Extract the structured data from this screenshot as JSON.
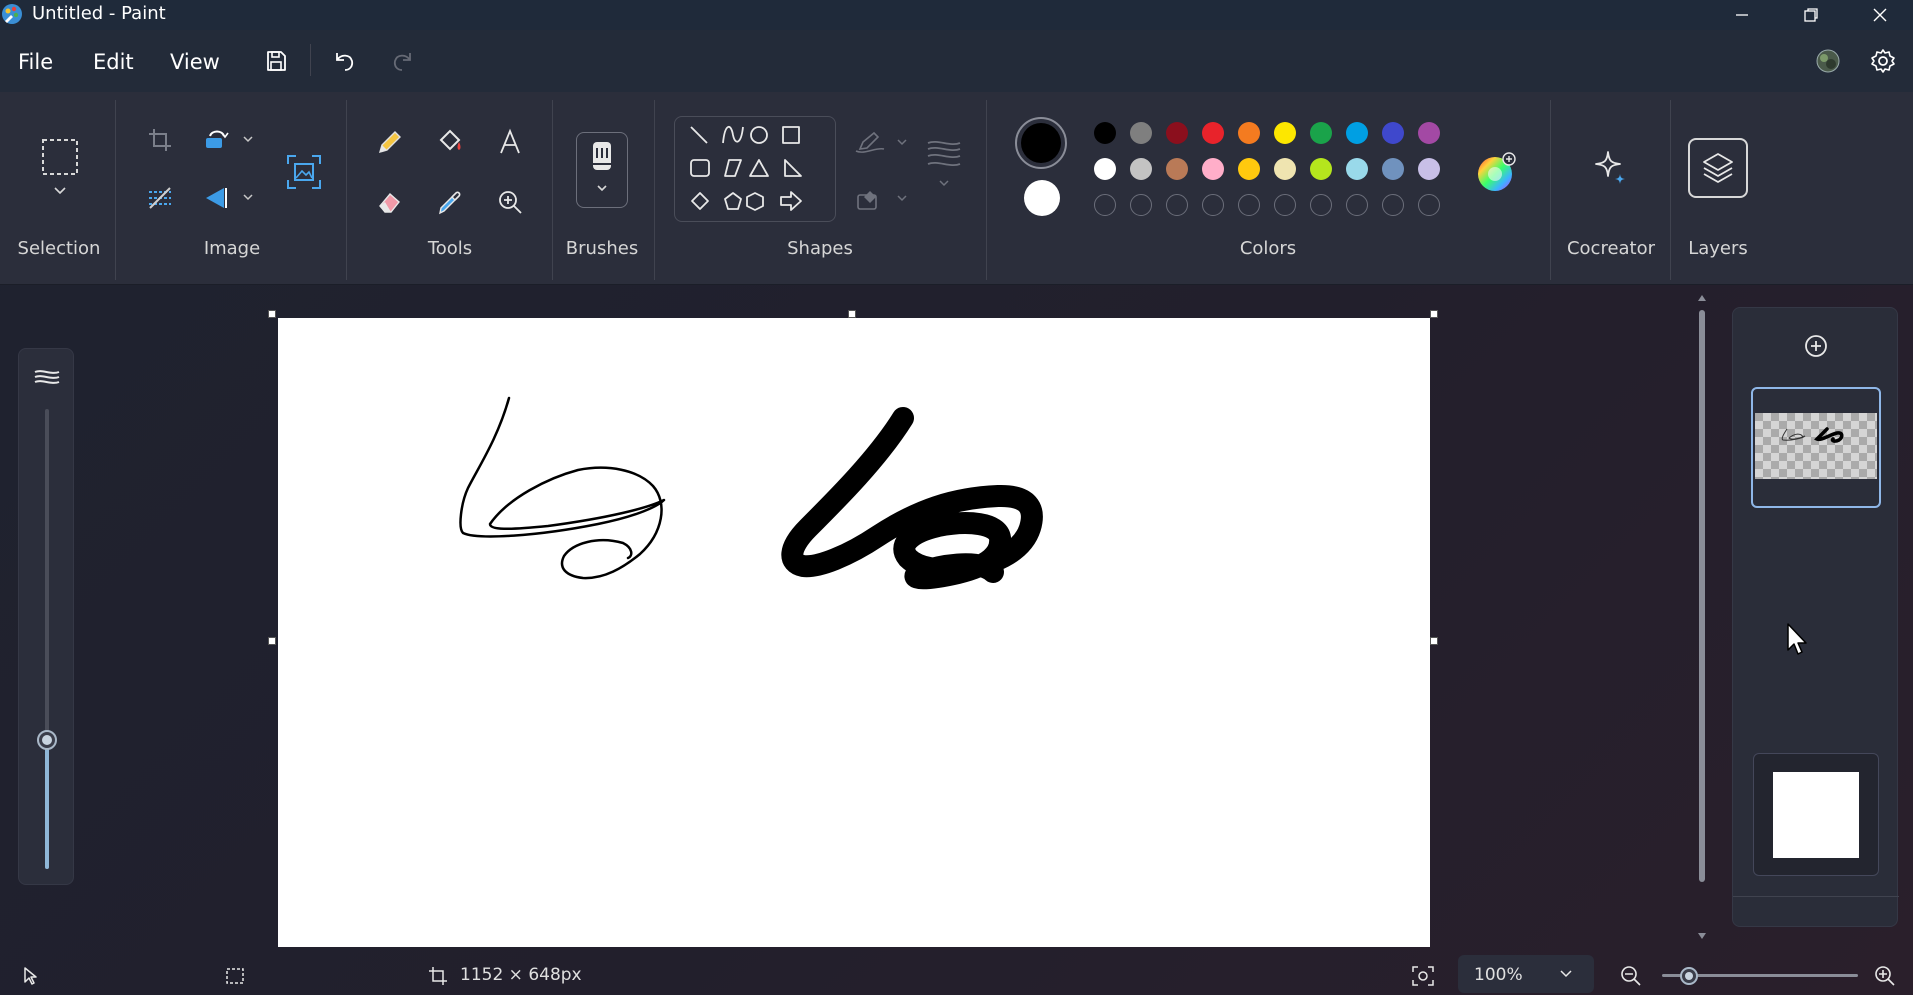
{
  "window": {
    "title": "Untitled - Paint",
    "controls": [
      "minimize-icon",
      "restore-icon",
      "close-icon"
    ]
  },
  "menu": {
    "file": "File",
    "edit": "Edit",
    "view": "View",
    "quick_actions": [
      "save-icon",
      "undo-icon",
      "redo-icon"
    ],
    "right_icons": [
      "account-icon",
      "settings-icon"
    ]
  },
  "ribbon": {
    "groups": {
      "selection": "Selection",
      "image": "Image",
      "tools": "Tools",
      "brushes": "Brushes",
      "shapes": "Shapes",
      "colors": "Colors",
      "cocreator": "Cocreator",
      "layers": "Layers"
    },
    "colors": {
      "primary": "#000000",
      "secondary": "#ffffff",
      "row1": [
        "#000000",
        "#7f7f7f",
        "#8b0f1d",
        "#e8232b",
        "#f47b20",
        "#fde700",
        "#1aa34a",
        "#009fe3",
        "#3f48cc",
        "#a349a4"
      ],
      "row2": [
        "#ffffff",
        "#c3c3c3",
        "#b97a57",
        "#ffaec9",
        "#ffc90e",
        "#efe4b0",
        "#b5e61d",
        "#99d9ea",
        "#7092be",
        "#c8bfe7"
      ]
    }
  },
  "canvas": {
    "background": "#ffffff"
  },
  "status": {
    "canvas_size": "1152 × 648px",
    "zoom": "100%",
    "zoom_level": 0.1
  }
}
